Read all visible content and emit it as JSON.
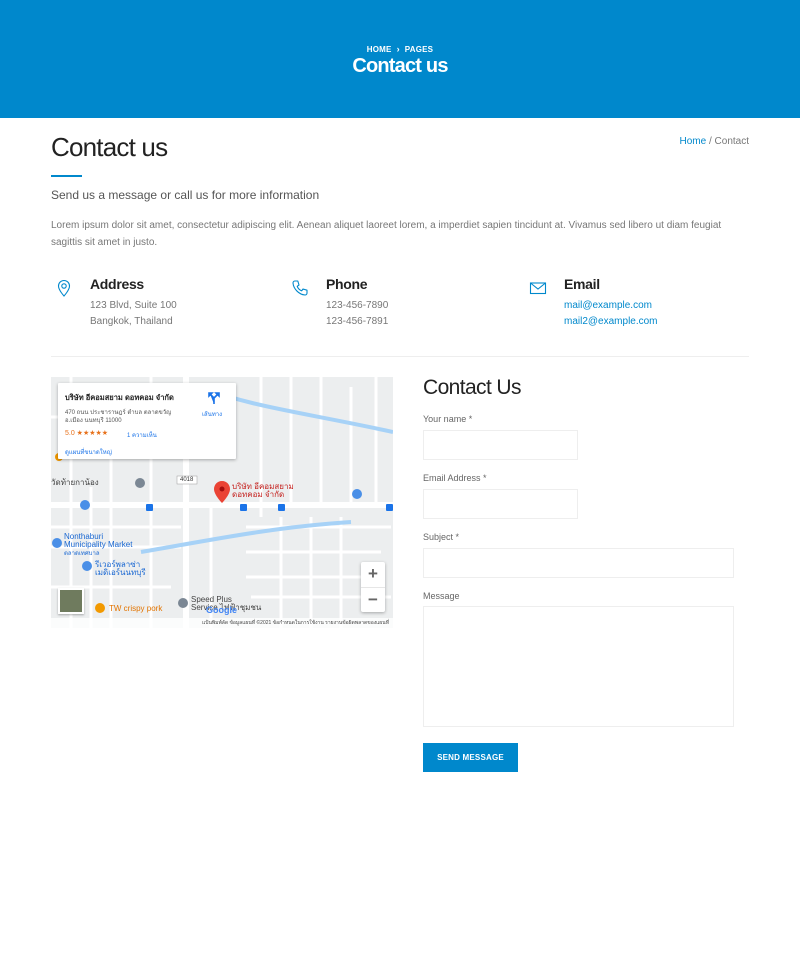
{
  "hero": {
    "breadcrumb": [
      "HOME",
      "PAGES"
    ],
    "title": "Contact us"
  },
  "page": {
    "title": "Contact us",
    "breadcrumb_home": "Home",
    "breadcrumb_separator": "/",
    "breadcrumb_current": "Contact",
    "subtitle": "Send us a message or call us for more information",
    "intro": "Lorem ipsum dolor sit amet, consectetur adipiscing elit. Aenean aliquet laoreet lorem, a imperdiet sapien tincidunt at. Vivamus sed libero ut diam feugiat sagittis sit amet in justo."
  },
  "info": {
    "address": {
      "title": "Address",
      "line1": "123 Blvd, Suite 100",
      "line2": "Bangkok, Thailand",
      "icon": "map-pin-icon"
    },
    "phone": {
      "title": "Phone",
      "line1": "123-456-7890",
      "line2": "123-456-7891",
      "icon": "phone-icon"
    },
    "email": {
      "title": "Email",
      "line1": "mail@example.com",
      "line2": "mail2@example.com",
      "icon": "envelope-icon"
    }
  },
  "map": {
    "card_name": "บริษัท อีคอมสยาม ดอทคอม จำกัด",
    "card_address_1": "470 ถนน ประชาราษฎร์ ตำบล ตลาดขวัญ",
    "card_address_2": "อ.เมือง นนทบุรี 11000",
    "card_rating": "5.0 ★★★★★",
    "card_reviews": "1 ความเห็น",
    "card_larger_map": "ดูแผนที่ขนาดใหญ่",
    "card_directions": "เส้นทาง",
    "pin_label_1": "บริษัท อีคอมสยาม",
    "pin_label_2": "ดอทคอม จำกัด",
    "place_temple": "วัดท้ายกาน้อง",
    "place_market_1": "Nonthaburi",
    "place_market_2": "Municipality Market",
    "place_market_3": "ตลาดเทศบาล",
    "place_hospital_1": "รีเวอร์พลาซ่า",
    "place_hospital_2": "เมดิเอร์นนทบุรี",
    "place_pork": "TW crispy pork",
    "place_speed_1": "Speed Plus",
    "place_speed_2": "Service ไฟฟ้าชุมชน",
    "road_number": "4018",
    "zoom_in": "+",
    "zoom_out": "−",
    "google": "Google",
    "footer": "แป้นพิมพ์ลัด   ข้อมูลแผนที่ ©2021   ข้อกำหนดในการใช้งาน   รายงานข้อผิดพลาดของแผนที่",
    "colors": {
      "water": "#a7d2f7",
      "pin": "#ea4335",
      "pin_label": "#c5221f"
    }
  },
  "form": {
    "title": "Contact Us",
    "name_label": "Your name *",
    "email_label": "Email Address *",
    "subject_label": "Subject *",
    "message_label": "Message",
    "name_value": "",
    "email_value": "",
    "subject_value": "",
    "message_value": "",
    "submit_label": "SEND MESSAGE"
  },
  "colors": {
    "accent": "#0088cc"
  }
}
